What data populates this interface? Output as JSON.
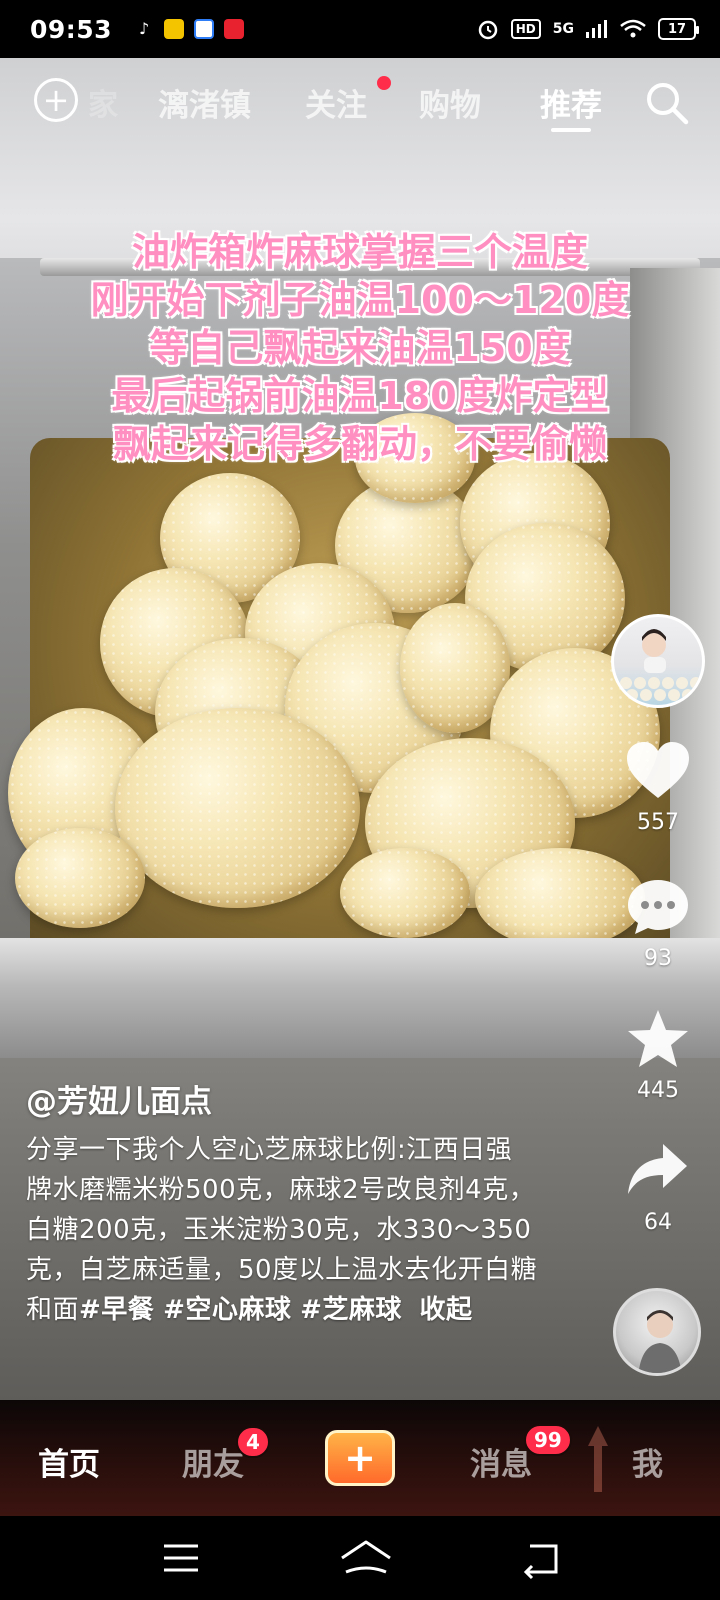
{
  "status_bar": {
    "time": "09:53",
    "network": "5G",
    "hd": "HD",
    "battery": "17"
  },
  "top_nav": {
    "partial_tab": "家",
    "tabs": [
      {
        "label": "漓渚镇",
        "active": false
      },
      {
        "label": "关注",
        "active": false,
        "dot": true
      },
      {
        "label": "购物",
        "active": false
      },
      {
        "label": "推荐",
        "active": true
      }
    ]
  },
  "video_overlay": {
    "lines": [
      "油炸箱炸麻球掌握三个温度",
      "刚开始下剂子油温100～120度",
      "等自己飘起来油温150度",
      "最后起锅前油温180度炸定型",
      "飘起来记得多翻动，不要偷懒"
    ],
    "text_color": "#ff8fc0"
  },
  "actions": {
    "likes": "557",
    "comments": "93",
    "favorites": "445",
    "shares": "64"
  },
  "post": {
    "author": "@芳妞儿面点",
    "description": "分享一下我个人空心芝麻球比例:江西日强牌水磨糯米粉500克，麻球2号改良剂4克，白糖200克，玉米淀粉30克，水330～350克，白芝麻适量，50度以上温水去化开白糖和面",
    "hashtags": [
      "#早餐",
      "#空心麻球",
      "#芝麻球"
    ],
    "collapse_label": "收起"
  },
  "bottom_nav": {
    "home": "首页",
    "friends": "朋友",
    "friends_badge": "4",
    "create": "+",
    "messages": "消息",
    "messages_badge": "99",
    "me": "我"
  },
  "colors": {
    "badge": "#ff2d4a",
    "create_button": "#ff6a2b"
  }
}
